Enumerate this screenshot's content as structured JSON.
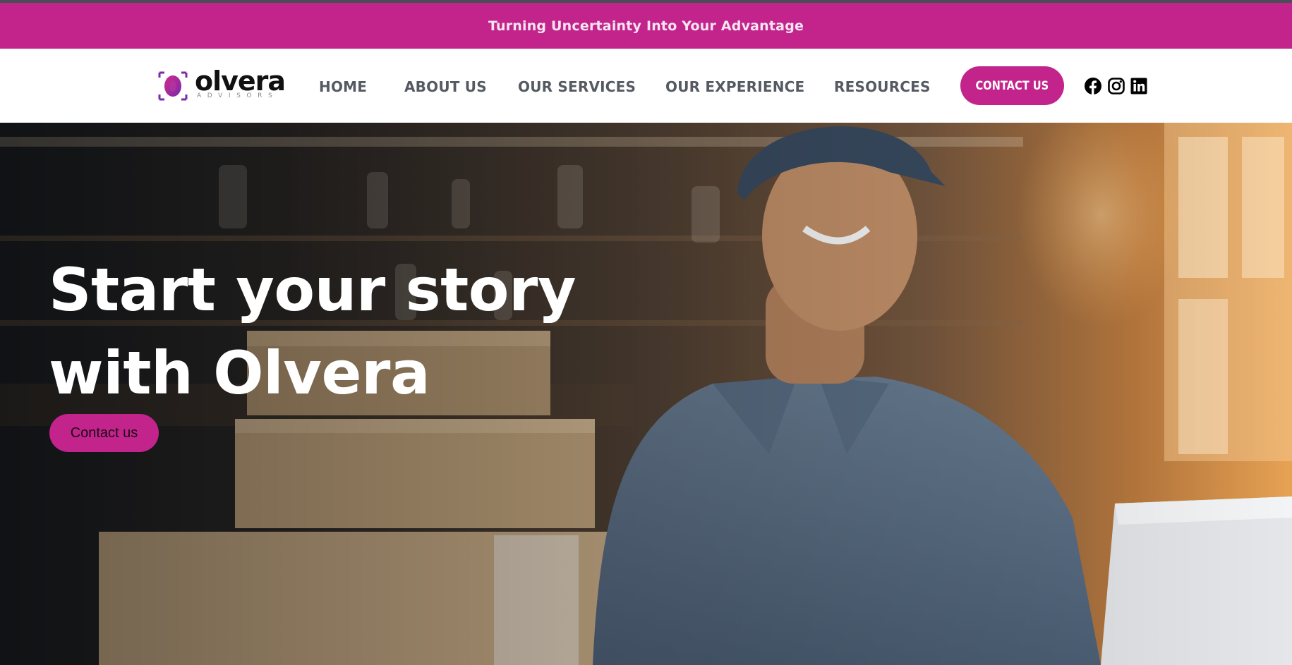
{
  "announcement": {
    "text": "Turning Uncertainty Into Your Advantage"
  },
  "brand": {
    "name": "olvera",
    "tagline": "ADVISORS",
    "color": "#c2248c"
  },
  "nav": {
    "items": [
      {
        "label": "HOME"
      },
      {
        "label": "ABOUT US"
      },
      {
        "label": "OUR SERVICES"
      },
      {
        "label": "OUR EXPERIENCE"
      },
      {
        "label": "RESOURCES"
      }
    ],
    "cta_label": "CONTACT US"
  },
  "social": [
    {
      "icon": "facebook-icon"
    },
    {
      "icon": "instagram-icon"
    },
    {
      "icon": "linkedin-icon"
    }
  ],
  "hero": {
    "title_line1": "Start your story",
    "title_line2": "with Olvera",
    "button_label": "Contact us"
  }
}
